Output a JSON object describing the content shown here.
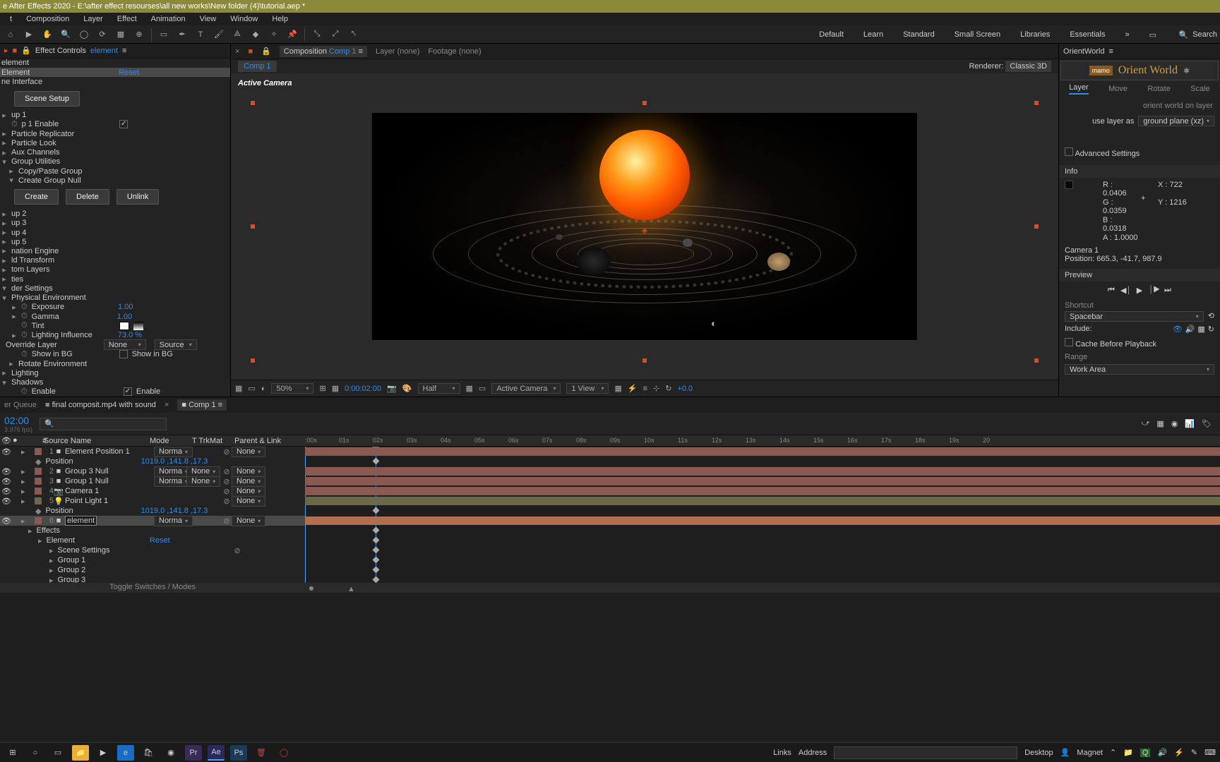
{
  "title_bar": "e After Effects 2020 - E:\\after effect resourses\\all new works\\New folder (4)\\tutorial.aep *",
  "menu": [
    "t",
    "Composition",
    "Layer",
    "Effect",
    "Animation",
    "View",
    "Window",
    "Help"
  ],
  "workspaces": [
    "Default",
    "Learn",
    "Standard",
    "Small Screen",
    "Libraries",
    "Essentials"
  ],
  "search_label": "Search",
  "effect_controls": {
    "tab": "Effect Controls",
    "layer": "element",
    "comp": "element",
    "effect_name": "Element",
    "reset": "Reset",
    "scene_interface": "ne Interface",
    "scene_setup": "Scene Setup",
    "rows": [
      "up 1",
      "p 1 Enable",
      "Particle Replicator",
      "Particle Look",
      "Aux Channels",
      "Group Utilities",
      "Copy/Paste Group",
      "Create Group Null"
    ],
    "create": "Create",
    "delete": "Delete",
    "unlink": "Unlink",
    "rows2": [
      "up 2",
      "up 3",
      "up 4",
      "up 5",
      "nation Engine",
      "ld Transform",
      "tom Layers",
      "ties",
      "der Settings",
      "Physical Environment"
    ],
    "exposure": "Exposure",
    "exposure_v": "1.00",
    "gamma": "Gamma",
    "gamma_v": "1.00",
    "tint": "Tint",
    "lighting_inf": "Lighting Influence",
    "lighting_v": "73.0 %",
    "override": "Override Layer",
    "override_v": "None",
    "source_v": "Source",
    "show_bg": "Show in BG",
    "show_bg2": "Show in BG",
    "rotate_env": "Rotate Environment",
    "lighting": "Lighting",
    "shadows": "Shadows",
    "enable": "Enable"
  },
  "composition": {
    "tabs": {
      "comp": "Composition",
      "comp_name": "Comp 1",
      "layer": "Layer  (none)",
      "footage": "Footage  (none)"
    },
    "breadcrumb": "Comp 1",
    "renderer_label": "Renderer:",
    "renderer": "Classic 3D",
    "active_camera": "Active Camera",
    "footer": {
      "zoom": "50%",
      "time": "0:00:02:00",
      "res": "Half",
      "view": "Active Camera",
      "views": "1 View",
      "exp": "+0.0"
    }
  },
  "orient_world": {
    "panel": "OrientWorld",
    "brand": "mamo",
    "title": "Orient World",
    "tabs": [
      "Layer",
      "Move",
      "Rotate",
      "Scale"
    ],
    "hint": "orient world on layer",
    "use_layer": "use layer as",
    "dropdown": "ground plane (xz)",
    "adv": "Advanced Settings"
  },
  "info": {
    "title": "Info",
    "r": "R : 0.0406",
    "g": "G : 0.0359",
    "b": "B : 0.0318",
    "a": "A : 1.0000",
    "x": "X : 722",
    "y": "Y : 1216",
    "cam": "Camera 1",
    "cam_pos": "Position: 665.3, -41.7, 987.9"
  },
  "preview": {
    "title": "Preview",
    "shortcut_h": "Shortcut",
    "shortcut": "Spacebar",
    "include": "Include:",
    "cache": "Cache Before Playback",
    "range_h": "Range",
    "range": "Work Area"
  },
  "timeline": {
    "tabs": {
      "queue": "er Queue",
      "final": "final composit.mp4 with sound",
      "comp": "Comp 1"
    },
    "time": "02:00",
    "fps": "3.976 fps)",
    "cols": {
      "src": "Source Name",
      "mode": "Mode",
      "trk": "T  TrkMat",
      "parent": "Parent & Link"
    },
    "ruler": [
      ":00s",
      "01s",
      "02s",
      "03s",
      "04s",
      "05s",
      "06s",
      "07s",
      "08s",
      "09s",
      "10s",
      "11s",
      "12s",
      "13s",
      "14s",
      "15s",
      "16s",
      "17s",
      "18s",
      "19s",
      "20"
    ],
    "layers": [
      {
        "idx": "1",
        "color": "salmon",
        "icon": "■",
        "name": "Element Position 1",
        "mode": "Norma",
        "parent": "None"
      },
      {
        "prop": "Position",
        "val": "1019.0 ,141.8 ,17.3"
      },
      {
        "idx": "2",
        "color": "salmon",
        "icon": "■",
        "name": "Group 3 Null",
        "mode": "Norma",
        "trk": "None",
        "parent": "None"
      },
      {
        "idx": "3",
        "color": "salmon",
        "icon": "■",
        "name": "Group 1 Null",
        "mode": "Norma",
        "trk": "None",
        "parent": "None"
      },
      {
        "idx": "4",
        "color": "salmon",
        "icon": "📷",
        "name": "Camera 1",
        "parent": "None"
      },
      {
        "idx": "5",
        "color": "olive",
        "icon": "💡",
        "name": "Point Light 1",
        "parent": "None"
      },
      {
        "prop": "Position",
        "val": "1019.0 ,141.8 ,17.3"
      },
      {
        "idx": "6",
        "color": "salmon",
        "icon": "■",
        "name": "element",
        "mode": "Norma",
        "parent": "None",
        "sel": true
      },
      {
        "sub": "Effects"
      },
      {
        "sub2": "Element",
        "reset": "Reset"
      },
      {
        "sub3": "Scene Settings"
      },
      {
        "sub3": "Group 1"
      },
      {
        "sub3": "Group 2"
      },
      {
        "sub3": "Group 3"
      }
    ],
    "toggle": "Toggle Switches / Modes"
  },
  "taskbar": {
    "links": "Links",
    "address_label": "Address",
    "desktop": "Desktop",
    "magnet": "Magnet"
  }
}
